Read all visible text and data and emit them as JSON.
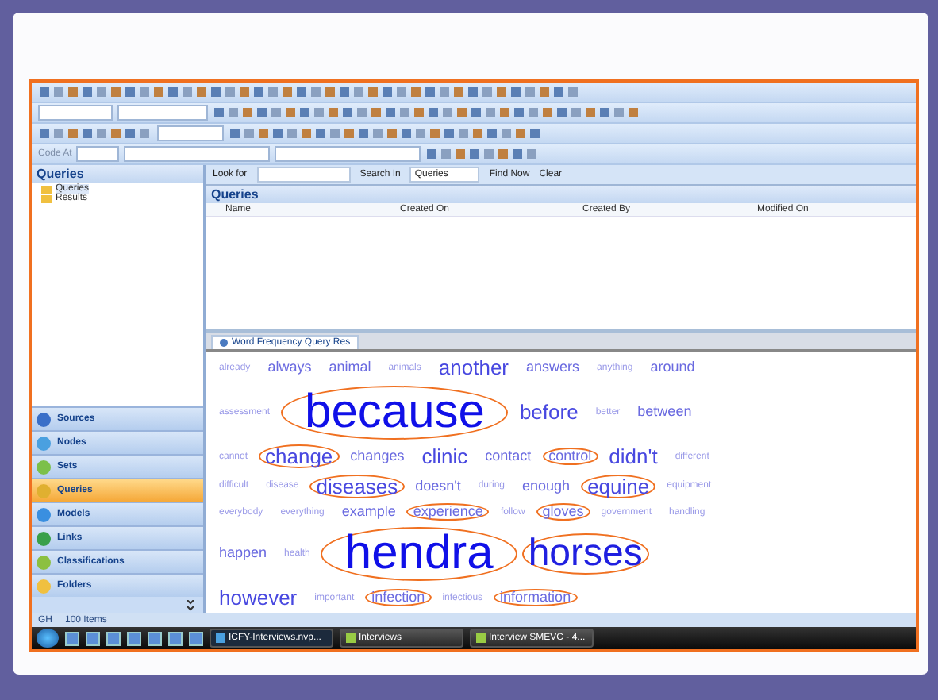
{
  "toolbar": {
    "code_at_label": "Code At"
  },
  "sidebar": {
    "title": "Queries",
    "tree": [
      {
        "label": "Queries",
        "selected": true
      },
      {
        "label": "Results",
        "selected": false
      }
    ],
    "nav": [
      {
        "label": "Sources",
        "selected": false,
        "color": "#3a6fc8"
      },
      {
        "label": "Nodes",
        "selected": false,
        "color": "#4aa0e0"
      },
      {
        "label": "Sets",
        "selected": false,
        "color": "#7cc04a"
      },
      {
        "label": "Queries",
        "selected": true,
        "color": "#e0b030"
      },
      {
        "label": "Models",
        "selected": false,
        "color": "#3a8fe0"
      },
      {
        "label": "Links",
        "selected": false,
        "color": "#3aa04a"
      },
      {
        "label": "Classifications",
        "selected": false,
        "color": "#8cc040"
      },
      {
        "label": "Folders",
        "selected": false,
        "color": "#f0c040"
      }
    ]
  },
  "find_bar": {
    "look_for_label": "Look for",
    "search_in_label": "Search In",
    "search_in_value": "Queries",
    "find_now": "Find Now",
    "clear": "Clear"
  },
  "list": {
    "title": "Queries",
    "columns": [
      "Name",
      "Created On",
      "Created By",
      "Modified On"
    ]
  },
  "result_tab": {
    "label": "Word Frequency Query Res"
  },
  "word_cloud": [
    [
      {
        "text": "already",
        "kind": "small",
        "circled": false
      },
      {
        "text": "always",
        "kind": "medium",
        "circled": false
      },
      {
        "text": "animal",
        "kind": "medium",
        "circled": false
      },
      {
        "text": "animals",
        "kind": "small",
        "circled": false
      },
      {
        "text": "another",
        "kind": "large",
        "circled": false
      },
      {
        "text": "answers",
        "kind": "medium",
        "circled": false
      },
      {
        "text": "anything",
        "kind": "small",
        "circled": false
      },
      {
        "text": "around",
        "kind": "medium",
        "circled": false
      }
    ],
    [
      {
        "text": "assessment",
        "kind": "small",
        "circled": false
      },
      {
        "text": "because",
        "kind": "huge",
        "circled": true
      },
      {
        "text": "before",
        "kind": "large",
        "circled": false
      },
      {
        "text": "better",
        "kind": "small",
        "circled": false
      },
      {
        "text": "between",
        "kind": "medium",
        "circled": false
      }
    ],
    [
      {
        "text": "cannot",
        "kind": "small",
        "circled": false
      },
      {
        "text": "change",
        "kind": "large",
        "circled": true
      },
      {
        "text": "changes",
        "kind": "medium",
        "circled": false
      },
      {
        "text": "clinic",
        "kind": "large",
        "circled": false
      },
      {
        "text": "contact",
        "kind": "medium",
        "circled": false
      },
      {
        "text": "control",
        "kind": "medium",
        "circled": true
      },
      {
        "text": "didn't",
        "kind": "large",
        "circled": false
      },
      {
        "text": "different",
        "kind": "small",
        "circled": false
      }
    ],
    [
      {
        "text": "difficult",
        "kind": "small",
        "circled": false
      },
      {
        "text": "disease",
        "kind": "small",
        "circled": false
      },
      {
        "text": "diseases",
        "kind": "large",
        "circled": true
      },
      {
        "text": "doesn't",
        "kind": "medium",
        "circled": false
      },
      {
        "text": "during",
        "kind": "small",
        "circled": false
      },
      {
        "text": "enough",
        "kind": "medium",
        "circled": false
      },
      {
        "text": "equine",
        "kind": "large",
        "circled": true
      },
      {
        "text": "equipment",
        "kind": "small",
        "circled": false
      }
    ],
    [
      {
        "text": "everybody",
        "kind": "small",
        "circled": false
      },
      {
        "text": "everything",
        "kind": "small",
        "circled": false
      },
      {
        "text": "example",
        "kind": "medium",
        "circled": false
      },
      {
        "text": "experience",
        "kind": "medium",
        "circled": true
      },
      {
        "text": "follow",
        "kind": "small",
        "circled": false
      },
      {
        "text": "gloves",
        "kind": "medium",
        "circled": true
      },
      {
        "text": "government",
        "kind": "small",
        "circled": false
      },
      {
        "text": "handling",
        "kind": "small",
        "circled": false
      }
    ],
    [
      {
        "text": "happen",
        "kind": "medium",
        "circled": false
      },
      {
        "text": "health",
        "kind": "small",
        "circled": false
      },
      {
        "text": "hendra",
        "kind": "huge",
        "circled": true
      },
      {
        "text": "horses",
        "kind": "xlarge",
        "circled": true
      }
    ],
    [
      {
        "text": "however",
        "kind": "large",
        "circled": false
      },
      {
        "text": "important",
        "kind": "small",
        "circled": false
      },
      {
        "text": "infection",
        "kind": "medium",
        "circled": true
      },
      {
        "text": "infectious",
        "kind": "small",
        "circled": false
      },
      {
        "text": "information",
        "kind": "medium",
        "circled": true
      }
    ]
  ],
  "status_bar": {
    "user": "GH",
    "items": "100 Items"
  },
  "taskbar": {
    "tasks": [
      {
        "label": "ICFY-Interviews.nvp...",
        "selected": true
      },
      {
        "label": "Interviews",
        "selected": false
      },
      {
        "label": "Interview SMEVC - 4...",
        "selected": false
      }
    ]
  }
}
